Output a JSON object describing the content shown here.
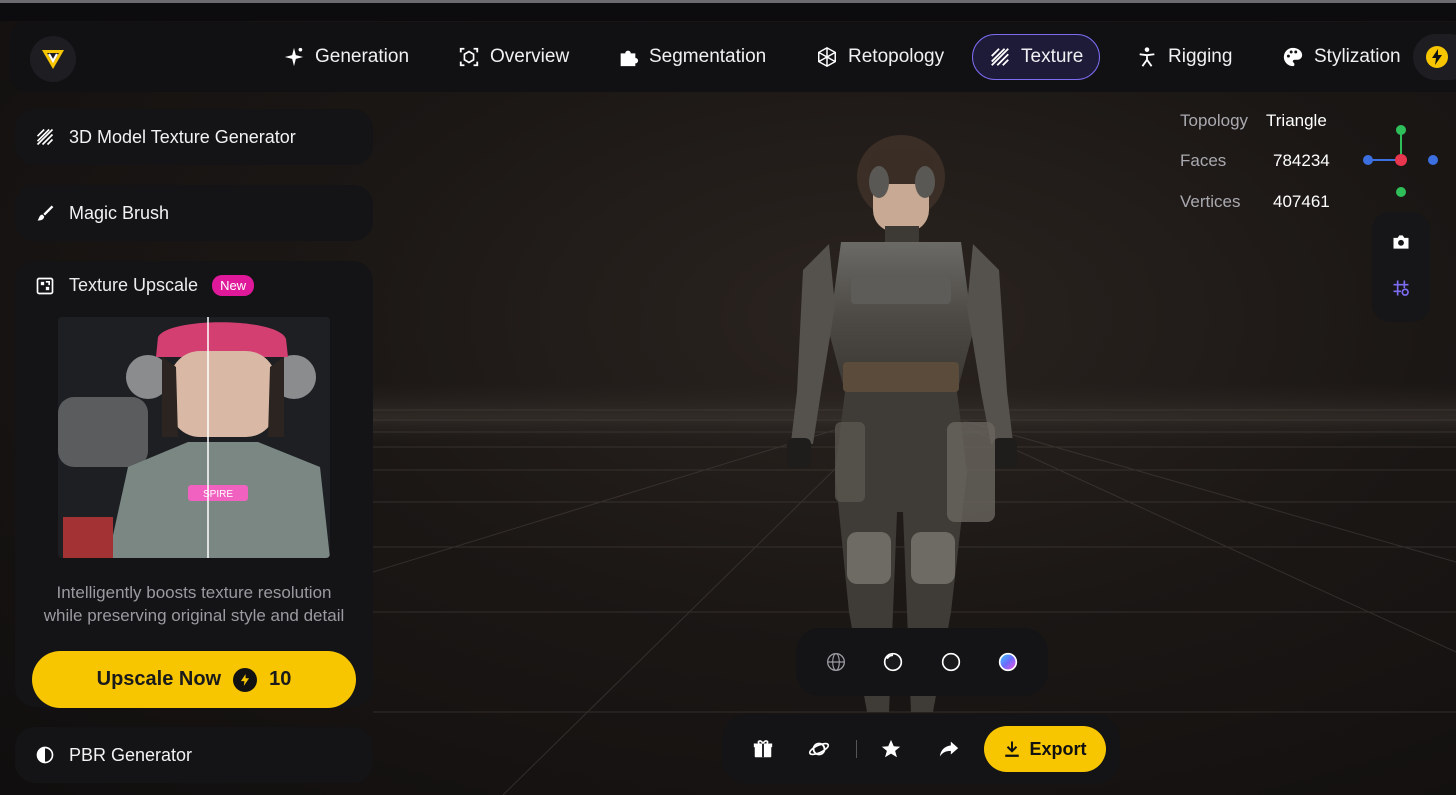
{
  "nav": {
    "items": [
      {
        "label": "Generation",
        "icon": "sparkle-icon"
      },
      {
        "label": "Overview",
        "icon": "cube-frame-icon"
      },
      {
        "label": "Segmentation",
        "icon": "puzzle-icon"
      },
      {
        "label": "Retopology",
        "icon": "mesh-cube-icon"
      },
      {
        "label": "Texture",
        "icon": "texture-stripes-icon",
        "active": true
      },
      {
        "label": "Rigging",
        "icon": "figure-icon"
      },
      {
        "label": "Stylization",
        "icon": "palette-icon"
      }
    ]
  },
  "sidebar": {
    "texture_generator": "3D Model Texture Generator",
    "magic_brush": "Magic Brush",
    "upscale": {
      "title": "Texture Upscale",
      "badge": "New",
      "description": "Intelligently boosts texture resolution while preserving original style and detail",
      "button_label": "Upscale Now",
      "cost": "10",
      "preview_patch": "SPIRE"
    },
    "pbr": "PBR Generator"
  },
  "stats": {
    "topology_label": "Topology",
    "topology_value": "Triangle",
    "faces_label": "Faces",
    "faces_value": "784234",
    "vertices_label": "Vertices",
    "vertices_value": "407461"
  },
  "toolbar": {
    "export_label": "Export"
  },
  "colors": {
    "accent_yellow": "#f7c600",
    "active_purple": "#7b6cf0",
    "badge_pink": "#e0199b"
  }
}
